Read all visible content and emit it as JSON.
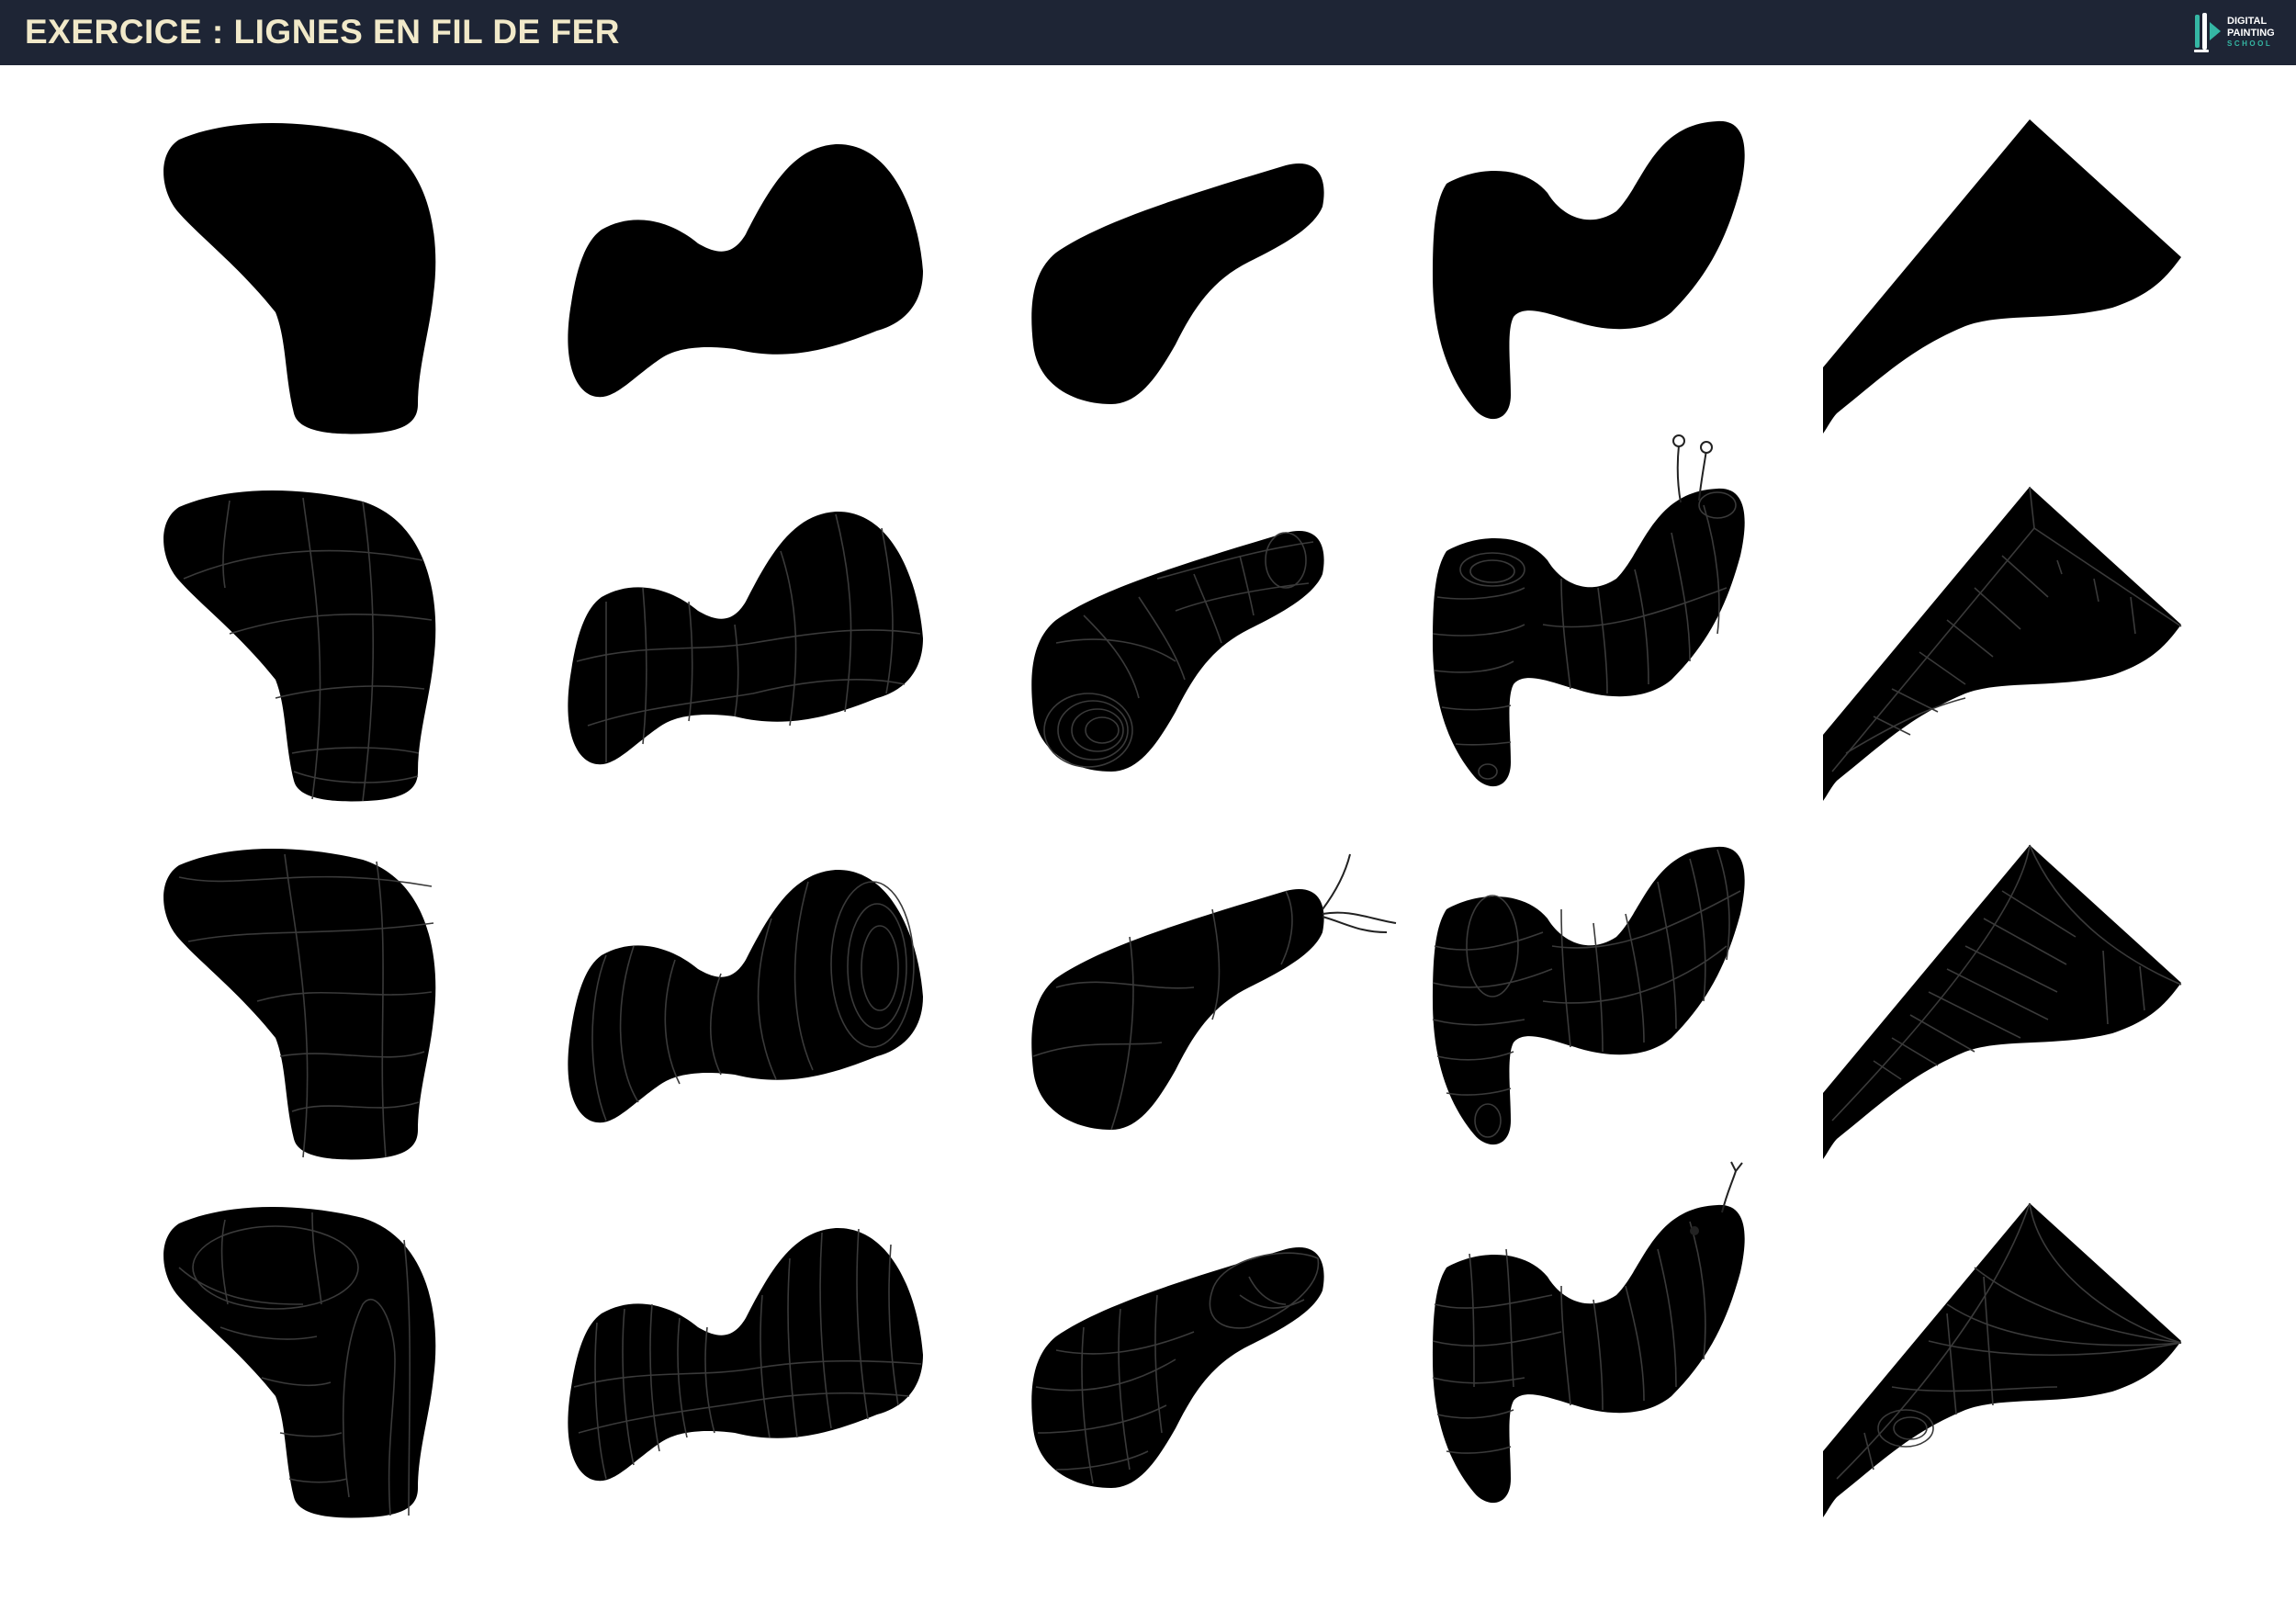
{
  "header": {
    "title": "EXERCICE : LIGNES EN FIL DE FER",
    "background": "#1e2535",
    "title_color": "#f1e9c9"
  },
  "logo": {
    "line1": "DIGITAL",
    "line2": "PAINTING",
    "line3": "SCHOOL",
    "accent": "#35b7a4"
  },
  "grid": {
    "rows": 4,
    "columns": 5,
    "row_descriptions": [
      "outline",
      "wireframe",
      "wireframe",
      "wireframe"
    ],
    "line_color": "#222222"
  }
}
